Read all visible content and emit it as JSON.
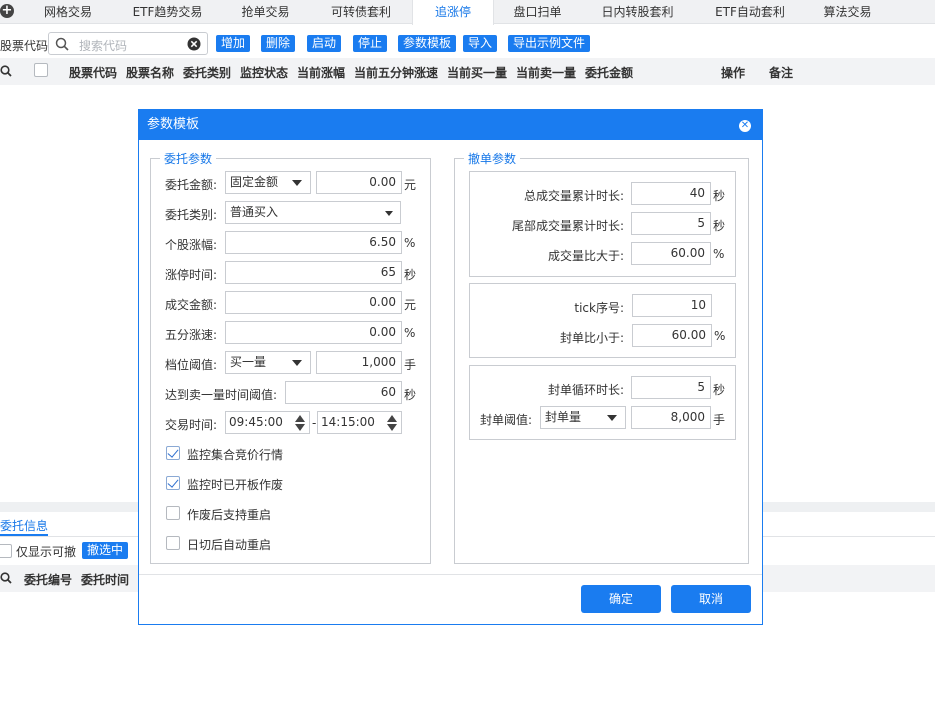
{
  "tabs": [
    "网格交易",
    "ETF趋势交易",
    "抢单交易",
    "可转债套利",
    "追涨停",
    "盘口扫单",
    "日内转股套利",
    "ETF自动套利",
    "算法交易"
  ],
  "active_tab": "追涨停",
  "toolbar": {
    "code_label": "股票代码",
    "search_placeholder": "搜索代码",
    "buttons": [
      "增加",
      "删除",
      "启动",
      "停止",
      "参数模板",
      "导入",
      "导出示例文件"
    ]
  },
  "table": {
    "columns": [
      "股票代码",
      "股票名称",
      "委托类别",
      "监控状态",
      "当前涨幅",
      "当前五分钟涨速",
      "当前买一量",
      "当前卖一量",
      "委托金额",
      "操作",
      "备注"
    ]
  },
  "bottom": {
    "tab": "委托信息",
    "only_cancel_label": "仅显示可撤",
    "cancel_selected": "撤选中",
    "columns": [
      "委托编号",
      "委托时间"
    ]
  },
  "dialog": {
    "title": "参数模板",
    "left_legend": "委托参数",
    "right_legend": "撤单参数",
    "left": {
      "amount_label": "委托金额:",
      "amount_type": "固定金额",
      "amount_value": "0.00",
      "amount_unit": "元",
      "category_label": "委托类别:",
      "category_value": "普通买入",
      "rise_label": "个股涨幅:",
      "rise_value": "6.50",
      "rise_unit": "%",
      "limit_time_label": "涨停时间:",
      "limit_time_value": "65",
      "limit_time_unit": "秒",
      "deal_amount_label": "成交金额:",
      "deal_amount_value": "0.00",
      "deal_amount_unit": "元",
      "speed_label": "五分涨速:",
      "speed_value": "0.00",
      "speed_unit": "%",
      "level_label": "档位阈值:",
      "level_type": "买一量",
      "level_value": "1,000",
      "level_unit": "手",
      "sell_time_label": "达到卖一量时间阈值:",
      "sell_time_value": "60",
      "sell_time_unit": "秒",
      "trade_time_label": "交易时间:",
      "trade_time_start": "09:45:00",
      "trade_time_dash": "-",
      "trade_time_end": "14:15:00",
      "checks": [
        {
          "label": "监控集合竞价行情",
          "checked": true
        },
        {
          "label": "监控时已开板作废",
          "checked": true
        },
        {
          "label": "作废后支持重启",
          "checked": false
        },
        {
          "label": "日切后自动重启",
          "checked": false
        }
      ]
    },
    "right": {
      "total_time_label": "总成交量累计时长:",
      "total_time_value": "40",
      "total_time_unit": "秒",
      "tail_time_label": "尾部成交量累计时长:",
      "tail_time_value": "5",
      "tail_time_unit": "秒",
      "ratio_label": "成交量比大于:",
      "ratio_value": "60.00",
      "ratio_unit": "%",
      "tick_label": "tick序号:",
      "tick_value": "10",
      "seal_ratio_label": "封单比小于:",
      "seal_ratio_value": "60.00",
      "seal_ratio_unit": "%",
      "cycle_label": "封单循环时长:",
      "cycle_value": "5",
      "cycle_unit": "秒",
      "threshold_label": "封单阈值:",
      "threshold_type": "封单量",
      "threshold_value": "8,000",
      "threshold_unit": "手"
    },
    "ok": "确定",
    "cancel": "取消"
  },
  "colors": {
    "accent": "#1a7cf0"
  }
}
